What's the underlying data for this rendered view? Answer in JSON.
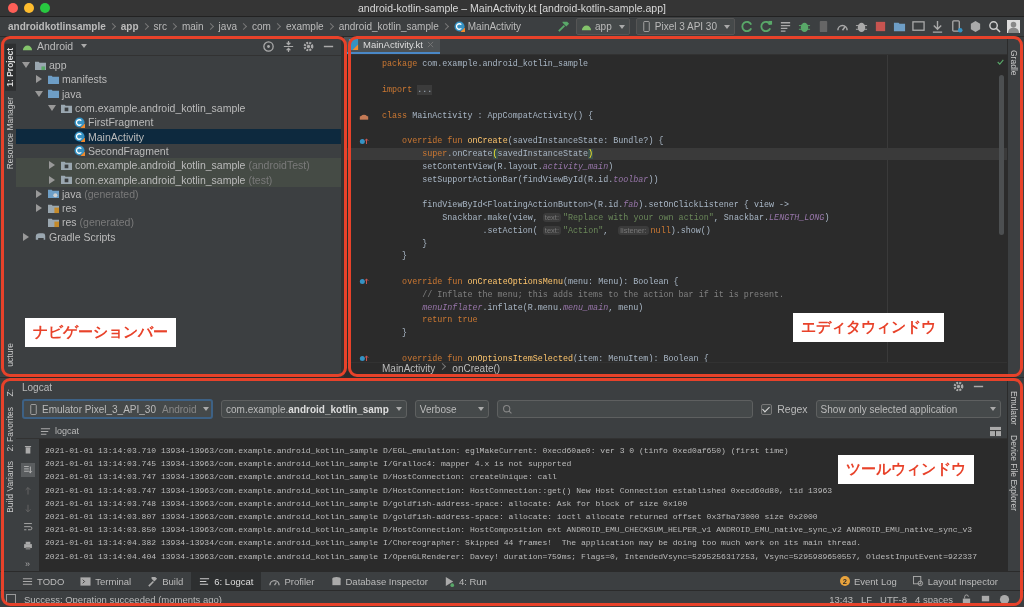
{
  "window": {
    "title": "android-kotlin-sample – MainActivity.kt [android-kotlin-sample.app]"
  },
  "breadcrumbs": [
    {
      "label": "androidkotlinsample",
      "bold": true,
      "kind": "path"
    },
    {
      "label": "app",
      "bold": true,
      "kind": "path"
    },
    {
      "label": "src",
      "bold": false,
      "kind": "path"
    },
    {
      "label": "main",
      "bold": false,
      "kind": "path"
    },
    {
      "label": "java",
      "bold": false,
      "kind": "path"
    },
    {
      "label": "com",
      "bold": false,
      "kind": "path"
    },
    {
      "label": "example",
      "bold": false,
      "kind": "path"
    },
    {
      "label": "android_kotlin_sample",
      "bold": false,
      "kind": "path"
    },
    {
      "label": "MainActivity",
      "bold": false,
      "kind": "class"
    }
  ],
  "run_toolbar": {
    "config": "app",
    "device": "Pixel 3 API 30"
  },
  "left_tabs_top": [
    {
      "label": "1: Project",
      "selected": true
    },
    {
      "label": "Resource Manager",
      "selected": false
    },
    {
      "label": "ucture",
      "selected": false
    }
  ],
  "project": {
    "view": "Android",
    "tree": [
      {
        "label": "app",
        "kind": "module",
        "expanded": true,
        "selected": false,
        "test": false,
        "children": [
          {
            "label": "manifests",
            "kind": "folder",
            "expanded": false,
            "selected": false,
            "test": false
          },
          {
            "label": "java",
            "kind": "folder",
            "expanded": true,
            "selected": false,
            "test": false,
            "children": [
              {
                "label": "com.example.android_kotlin_sample",
                "kind": "package",
                "expanded": true,
                "selected": false,
                "test": false,
                "children": [
                  {
                    "label": "FirstFragment",
                    "kind": "class",
                    "selected": false,
                    "test": false
                  },
                  {
                    "label": "MainActivity",
                    "kind": "class",
                    "selected": true,
                    "test": false
                  },
                  {
                    "label": "SecondFragment",
                    "kind": "class",
                    "selected": false,
                    "test": false
                  }
                ]
              },
              {
                "label": "com.example.android_kotlin_sample",
                "suffix": "(androidTest)",
                "kind": "package",
                "expanded": false,
                "selected": false,
                "test": true
              },
              {
                "label": "com.example.android_kotlin_sample",
                "suffix": "(test)",
                "kind": "package",
                "expanded": false,
                "selected": false,
                "test": true
              }
            ]
          },
          {
            "label": "java",
            "suffix": "(generated)",
            "kind": "generated-folder",
            "expanded": false,
            "selected": false,
            "test": false
          },
          {
            "label": "res",
            "kind": "res-folder",
            "expanded": false,
            "selected": false,
            "test": false
          },
          {
            "label": "res",
            "suffix": "(generated)",
            "kind": "res-folder",
            "selected": false,
            "test": false
          }
        ]
      },
      {
        "label": "Gradle Scripts",
        "kind": "gradle",
        "expanded": false,
        "selected": false,
        "test": false
      }
    ]
  },
  "editor": {
    "tabs": [
      {
        "label": "MainActivity.kt",
        "selected": true
      }
    ],
    "lines": [
      {
        "current": false,
        "kind": "code",
        "segments": [
          {
            "text": "package ",
            "kind": "kw"
          },
          {
            "text": "com.example.android_kotlin_sample",
            "kind": "plain"
          }
        ]
      },
      {
        "current": false,
        "kind": "code"
      },
      {
        "current": false,
        "kind": "code",
        "segments": [
          {
            "text": "import ",
            "kind": "kw"
          },
          {
            "text": "...",
            "kind": "fold"
          }
        ]
      },
      {
        "current": false,
        "kind": "code"
      },
      {
        "current": false,
        "kind": "class",
        "segments": [
          {
            "text": "class ",
            "kind": "kw"
          },
          {
            "text": "MainActivity : AppCompatActivity() {",
            "kind": "plain"
          }
        ]
      },
      {
        "current": false,
        "kind": "code"
      },
      {
        "current": false,
        "kind": "override",
        "segments": [
          {
            "text": "    override fun ",
            "kind": "kw"
          },
          {
            "text": "onCreate",
            "kind": "fn"
          },
          {
            "text": "(savedInstanceState: Bundle?) {",
            "kind": "plain"
          }
        ]
      },
      {
        "current": true,
        "kind": "code",
        "segments": [
          {
            "text": "        super",
            "kind": "kw"
          },
          {
            "text": ".onCreate",
            "kind": "plain"
          },
          {
            "text": "(",
            "kind": "match"
          },
          {
            "text": "savedInstanceState",
            "kind": "plain"
          },
          {
            "text": ")",
            "kind": "match"
          }
        ]
      },
      {
        "current": false,
        "kind": "code",
        "segments": [
          {
            "text": "        setContentView(R.layout.",
            "kind": "plain"
          },
          {
            "text": "activity_main",
            "kind": "field"
          },
          {
            "text": ")",
            "kind": "plain"
          }
        ]
      },
      {
        "current": false,
        "kind": "code",
        "segments": [
          {
            "text": "        setSupportActionBar(findViewById(R.id.",
            "kind": "plain"
          },
          {
            "text": "toolbar",
            "kind": "field"
          },
          {
            "text": "))",
            "kind": "plain"
          }
        ]
      },
      {
        "current": false,
        "kind": "code"
      },
      {
        "current": false,
        "kind": "code",
        "segments": [
          {
            "text": "        findViewById<FloatingActionButton>(R.id.",
            "kind": "plain"
          },
          {
            "text": "fab",
            "kind": "field"
          },
          {
            "text": ").setOnClickListener { view ->",
            "kind": "plain"
          }
        ]
      },
      {
        "current": false,
        "kind": "code",
        "segments": [
          {
            "text": "            Snackbar.make(view, ",
            "kind": "plain"
          },
          {
            "text": "text:",
            "kind": "hint"
          },
          {
            "text": "\"Replace with your own action\"",
            "kind": "str"
          },
          {
            "text": ", Snackbar.",
            "kind": "plain"
          },
          {
            "text": "LENGTH_LONG",
            "kind": "field"
          },
          {
            "text": ")",
            "kind": "plain"
          }
        ]
      },
      {
        "current": false,
        "kind": "code",
        "segments": [
          {
            "text": "                    .setAction( ",
            "kind": "plain"
          },
          {
            "text": "text:",
            "kind": "hint"
          },
          {
            "text": "\"Action\"",
            "kind": "str"
          },
          {
            "text": ",  ",
            "kind": "plain"
          },
          {
            "text": "listener:",
            "kind": "hint"
          },
          {
            "text": "null",
            "kind": "kw"
          },
          {
            "text": ").show()",
            "kind": "plain"
          }
        ]
      },
      {
        "current": false,
        "kind": "code",
        "segments": [
          {
            "text": "        }",
            "kind": "plain"
          }
        ]
      },
      {
        "current": false,
        "kind": "code",
        "segments": [
          {
            "text": "    }",
            "kind": "plain"
          }
        ]
      },
      {
        "current": false,
        "kind": "code"
      },
      {
        "current": false,
        "kind": "override",
        "segments": [
          {
            "text": "    override fun ",
            "kind": "kw"
          },
          {
            "text": "onCreateOptionsMenu",
            "kind": "fn"
          },
          {
            "text": "(menu: Menu): Boolean {",
            "kind": "plain"
          }
        ]
      },
      {
        "current": false,
        "kind": "code",
        "segments": [
          {
            "text": "        // Inflate the menu; this adds items to the action bar if it is present.",
            "kind": "comment"
          }
        ]
      },
      {
        "current": false,
        "kind": "code",
        "segments": [
          {
            "text": "        menuInflater",
            "kind": "field"
          },
          {
            "text": ".inflate(R.menu.",
            "kind": "plain"
          },
          {
            "text": "menu_main",
            "kind": "field"
          },
          {
            "text": ", menu)",
            "kind": "plain"
          }
        ]
      },
      {
        "current": false,
        "kind": "code",
        "segments": [
          {
            "text": "        return true",
            "kind": "kw"
          }
        ]
      },
      {
        "current": false,
        "kind": "code",
        "segments": [
          {
            "text": "    }",
            "kind": "plain"
          }
        ]
      },
      {
        "current": false,
        "kind": "code"
      },
      {
        "current": false,
        "kind": "override",
        "segments": [
          {
            "text": "    override fun ",
            "kind": "kw"
          },
          {
            "text": "onOptionsItemSelected",
            "kind": "fn"
          },
          {
            "text": "(item: MenuItem): Boolean {",
            "kind": "plain"
          }
        ]
      }
    ],
    "breadcrumbs": [
      "MainActivity",
      "onCreate()"
    ]
  },
  "right_tabs_top": [
    {
      "label": "Gradle"
    }
  ],
  "logcat": {
    "title": "Logcat",
    "device": "Emulator Pixel_3_API_30",
    "device_note": "Android",
    "process": "com.example.**android_kotlin_samp**",
    "level": "Verbose",
    "regex": {
      "label": "Regex",
      "checked": true
    },
    "filter": "Show only selected application",
    "view_label": "logcat",
    "more": "»",
    "lines": [
      "2021-01-01 13:14:03.710 13934-13963/com.example.android_kotlin_sample D/EGL_emulation: eglMakeCurrent: 0xecd60ae0: ver 3 0 (tinfo 0xed0af650) (first time)",
      "2021-01-01 13:14:03.745 13934-13963/com.example.android_kotlin_sample I/Gralloc4: mapper 4.x is not supported",
      "2021-01-01 13:14:03.747 13934-13963/com.example.android_kotlin_sample D/HostConnection: createUnique: call",
      "2021-01-01 13:14:03.747 13934-13963/com.example.android_kotlin_sample D/HostConnection: HostConnection::get() New Host Connection established 0xecd60d80, tid 13963",
      "2021-01-01 13:14:03.748 13934-13963/com.example.android_kotlin_sample D/goldfish-address-space: allocate: Ask for block of size 0x100",
      "2021-01-01 13:14:03.807 13934-13963/com.example.android_kotlin_sample D/goldfish-address-space: allocate: ioctl allocate returned offset 0x3fba73000 size 0x2000",
      "2021-01-01 13:14:03.850 13934-13963/com.example.android_kotlin_sample D/HostConnection: HostComposition ext ANDROID_EMU_CHECKSUM_HELPER_v1 ANDROID_EMU_native_sync_v2 ANDROID_EMU_native_sync_v3",
      "2021-01-01 13:14:04.382 13934-13934/com.example.android_kotlin_sample I/Choreographer: Skipped 44 frames!  The application may be doing too much work on its main thread.",
      "2021-01-01 13:14:04.404 13934-13963/com.example.android_kotlin_sample I/OpenGLRenderer: Davey! duration=759ms; Flags=0, IntendedVsync=5295256317253, Vsync=5295989650557, OldestInputEvent=922337"
    ]
  },
  "left_tabs_bottom": [
    {
      "label": "Z:"
    },
    {
      "label": "2: Favorites"
    },
    {
      "label": "Build Variants"
    }
  ],
  "right_tabs_bottom": [
    {
      "label": "Emulator"
    },
    {
      "label": "Device File Explorer"
    }
  ],
  "bottom_tabs": [
    {
      "label": "TODO",
      "kind": "list",
      "selected": false
    },
    {
      "label": "Terminal",
      "kind": "terminal",
      "selected": false
    },
    {
      "label": "Build",
      "kind": "hammer",
      "selected": false
    },
    {
      "label": "6: Logcat",
      "kind": "lines",
      "selected": true
    },
    {
      "label": "Profiler",
      "kind": "gauge",
      "selected": false
    },
    {
      "label": "Database Inspector",
      "kind": "database",
      "selected": false
    },
    {
      "label": "4: Run",
      "kind": "play",
      "selected": false
    }
  ],
  "bottom_right_tabs": [
    {
      "label": "Event Log",
      "badge": "2"
    },
    {
      "label": "Layout Inspector"
    }
  ],
  "status": {
    "message": "Success: Operation succeeded (moments ago)",
    "items": [
      "13:43",
      "LF",
      "UTF-8",
      "4 spaces"
    ]
  },
  "annotations": [
    {
      "label": "ナビゲーションバー"
    },
    {
      "label": "エディタウィンドウ"
    },
    {
      "label": "ツールウィンドウ"
    }
  ]
}
